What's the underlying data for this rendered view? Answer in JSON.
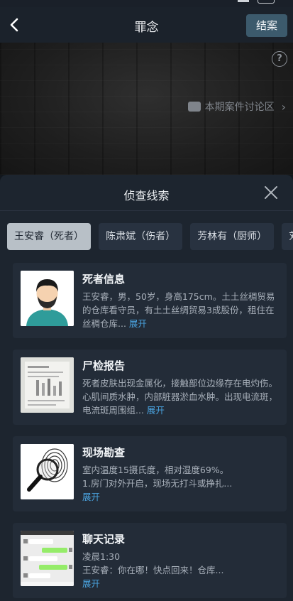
{
  "nav": {
    "title": "罪念",
    "end_button": "结案"
  },
  "scene": {
    "discuss_label": "本期案件讨论区",
    "help_label": "?"
  },
  "sheet": {
    "title": "侦查线索",
    "tabs": [
      {
        "label": "王安睿（死者）",
        "active": true
      },
      {
        "label": "陈肃斌（伤者）",
        "active": false
      },
      {
        "label": "芳林有（厨师）",
        "active": false
      },
      {
        "label": "刘修",
        "active": false
      }
    ],
    "cards": [
      {
        "title": "死者信息",
        "text": "王安睿，男，50岁，身高175cm。土土丝稠贸易的仓库看守员，有土土丝绸贸易3成股份，租住在丝稠仓库...",
        "expand": "展开",
        "icon": "avatar-icon"
      },
      {
        "title": "尸检报告",
        "text": "死者皮肤出现金属化，接触部位边缘存在电灼伤。心肌间质水肿，内部脏器淤血水肿。出现电流斑，电流斑周围组...",
        "expand": "展开",
        "icon": "document-icon"
      },
      {
        "title": "现场勘查",
        "line1": "室内温度15摄氏度，相对湿度69%。",
        "line2": "1.房门对外开启，现场无打斗或挣扎...",
        "expand": "展开",
        "icon": "fingerprint-magnifier-icon"
      },
      {
        "title": "聊天记录",
        "line1": "凌晨1:30",
        "line2": "王安睿：你在哪！快点回来！仓库...",
        "expand": "展开",
        "icon": "chat-screenshot-icon"
      }
    ]
  }
}
